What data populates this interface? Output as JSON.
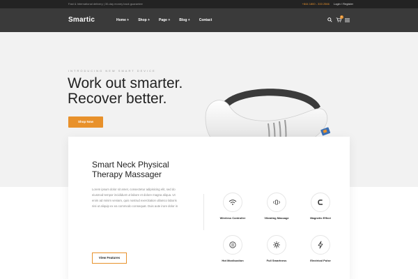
{
  "topbar": {
    "promo": "Fast & International delivery  |  30-day money back guarantee",
    "phone": "+844 1800 - 333 2566",
    "account": "Login / Register"
  },
  "nav": {
    "logo": "Smartic",
    "items": [
      "Home +",
      "Shop +",
      "Page +",
      "Blog +",
      "Contact"
    ],
    "cart_count": "0",
    "icons": [
      "search-icon",
      "cart-icon",
      "menu-icon"
    ]
  },
  "hero": {
    "eyebrow": "INTRODUCING NEW SMART DEVICE",
    "headline_line1": "Work out smarter.",
    "headline_line2": "Recover better.",
    "cta": "Shop Now"
  },
  "features": {
    "title": "Smart Neck Physical Therapy Massager",
    "description": "Lorem ipsum dolor sit amet, consectetur adipisicing elit, sed do eiusmod tempor incididunt ut labore et dolore magna aliqua. Ut enim ad minim veniam, quis nostrud exercitation ullamco laboris nisi ut aliquip ex ea commodo consequat. Duis aute irure dolor in",
    "cta": "View Features",
    "items": [
      {
        "label": "Wireless Controller",
        "icon": "wifi-icon"
      },
      {
        "label": "Vibrating Massage",
        "icon": "vibrate-icon"
      },
      {
        "label": "Magnetic Effect",
        "icon": "magnet-icon"
      },
      {
        "label": "Hot Moxibustion",
        "icon": "heat-icon"
      },
      {
        "label": "Full Smartness",
        "icon": "spark-icon"
      },
      {
        "label": "Electrical Pulse",
        "icon": "bolt-icon"
      }
    ]
  },
  "colors": {
    "accent": "#e8912b",
    "nav_bg": "#3a3a3a",
    "topbar_bg": "#232323",
    "hero_bg": "#f2f2f2"
  }
}
